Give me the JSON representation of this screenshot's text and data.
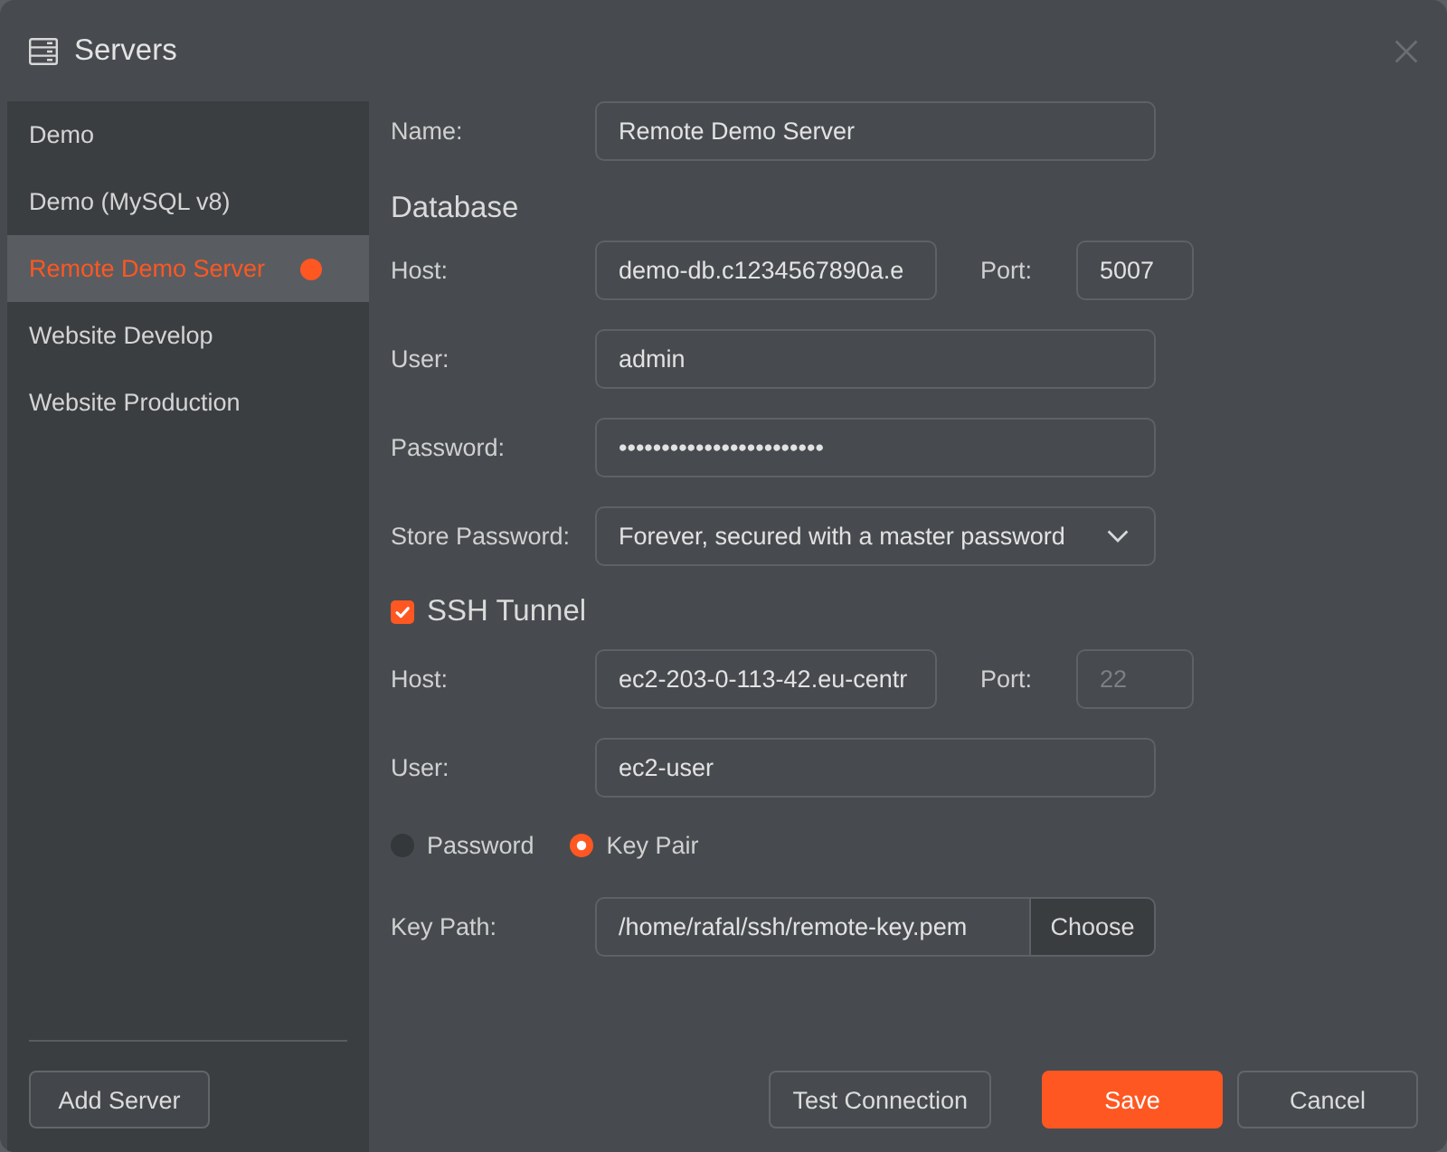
{
  "window": {
    "title": "Servers"
  },
  "sidebar": {
    "items": [
      {
        "label": "Demo",
        "selected": false,
        "modified": false
      },
      {
        "label": "Demo (MySQL v8)",
        "selected": false,
        "modified": false
      },
      {
        "label": "Remote Demo Server",
        "selected": true,
        "modified": true
      },
      {
        "label": "Website Develop",
        "selected": false,
        "modified": false
      },
      {
        "label": "Website Production",
        "selected": false,
        "modified": false
      }
    ],
    "add_button": "Add Server"
  },
  "form": {
    "name": {
      "label": "Name:",
      "value": "Remote Demo Server"
    },
    "database": {
      "heading": "Database",
      "host": {
        "label": "Host:",
        "value": "demo-db.c1234567890a.e"
      },
      "port": {
        "label": "Port:",
        "value": "5007"
      },
      "user": {
        "label": "User:",
        "value": "admin"
      },
      "password": {
        "label": "Password:",
        "value": "••••••••••••••••••••••••"
      },
      "store_password": {
        "label": "Store Password:",
        "value": "Forever, secured with a master password"
      }
    },
    "ssh_tunnel": {
      "label": "SSH Tunnel",
      "checked": true,
      "host": {
        "label": "Host:",
        "value": "ec2-203-0-113-42.eu-centr"
      },
      "port": {
        "label": "Port:",
        "placeholder": "22"
      },
      "user": {
        "label": "User:",
        "value": "ec2-user"
      },
      "auth": [
        {
          "label": "Password",
          "selected": false
        },
        {
          "label": "Key Pair",
          "selected": true
        }
      ],
      "key_path": {
        "label": "Key Path:",
        "value": "/home/rafal/ssh/remote-key.pem",
        "button": "Choose"
      }
    }
  },
  "buttons": [
    {
      "label": "Test Connection",
      "kind": "secondary"
    },
    {
      "label": "Save",
      "kind": "primary"
    },
    {
      "label": "Cancel",
      "kind": "secondary"
    }
  ]
}
